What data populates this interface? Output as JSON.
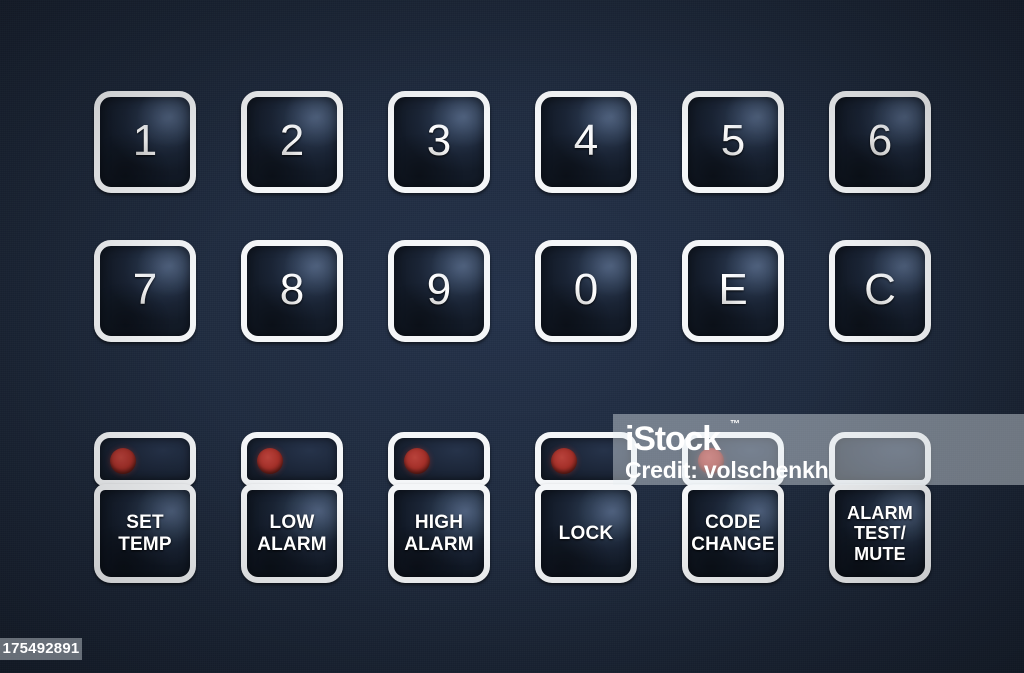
{
  "device": {
    "name": "alarm-control-keypad",
    "panel_color": "#1e2a3c",
    "key_border_color": "#f4f6f8",
    "key_face_color": "#1a2435",
    "led_color": "#ac3129",
    "label_color": "#ffffff"
  },
  "keypad": {
    "rows": [
      {
        "name": "numeric-row-1",
        "keys": [
          {
            "label": "1",
            "name": "key-1"
          },
          {
            "label": "2",
            "name": "key-2"
          },
          {
            "label": "3",
            "name": "key-3"
          },
          {
            "label": "4",
            "name": "key-4"
          },
          {
            "label": "5",
            "name": "key-5"
          },
          {
            "label": "6",
            "name": "key-6"
          }
        ]
      },
      {
        "name": "numeric-row-2",
        "keys": [
          {
            "label": "7",
            "name": "key-7"
          },
          {
            "label": "8",
            "name": "key-8"
          },
          {
            "label": "9",
            "name": "key-9"
          },
          {
            "label": "0",
            "name": "key-0"
          },
          {
            "label": "E",
            "name": "key-e-enter"
          },
          {
            "label": "C",
            "name": "key-c-clear"
          }
        ]
      }
    ]
  },
  "function_buttons": [
    {
      "name": "set-temp-button",
      "line1": "SET",
      "line2": "TEMP",
      "led": true,
      "led_state": "on"
    },
    {
      "name": "low-alarm-button",
      "line1": "LOW",
      "line2": "ALARM",
      "led": true,
      "led_state": "on"
    },
    {
      "name": "high-alarm-button",
      "line1": "HIGH",
      "line2": "ALARM",
      "led": true,
      "led_state": "on"
    },
    {
      "name": "lock-button",
      "line1": "LOCK",
      "line2": "",
      "led": true,
      "led_state": "on"
    },
    {
      "name": "code-change-button",
      "line1": "CODE",
      "line2": "CHANGE",
      "led": true,
      "led_state": "on"
    },
    {
      "name": "alarm-test-mute-button",
      "line1": "ALARM",
      "line2": "TEST/",
      "line3": "MUTE",
      "led": false,
      "led_state": "off"
    }
  ],
  "watermark": {
    "logo": "iStock",
    "trademark": "™",
    "credit": "Credit: volschenkh",
    "asset_id": "175492891"
  }
}
